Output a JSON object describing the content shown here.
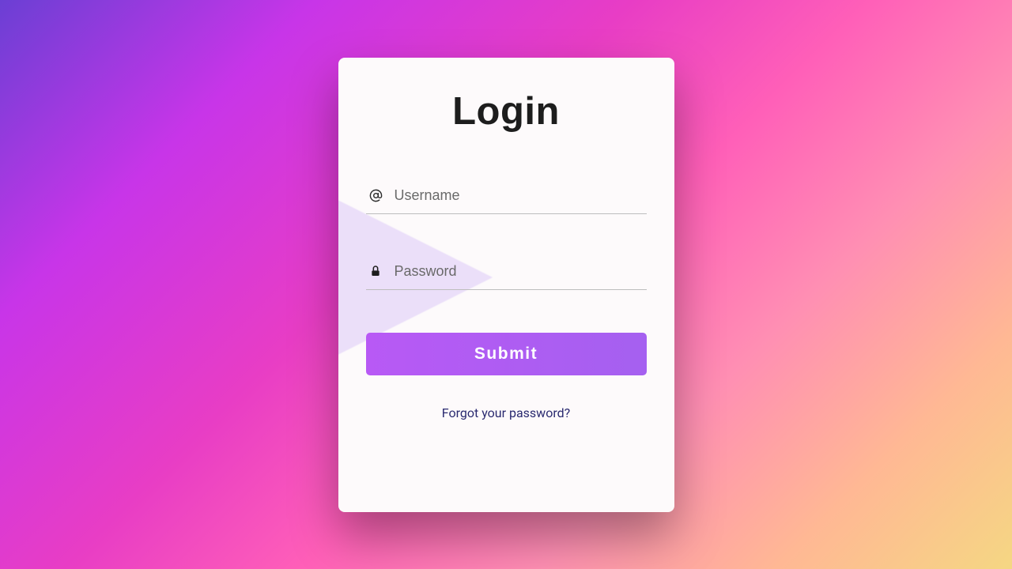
{
  "card": {
    "title": "Login",
    "username": {
      "placeholder": "Username",
      "value": "",
      "icon": "at-icon"
    },
    "password": {
      "placeholder": "Password",
      "value": "",
      "icon": "lock-icon"
    },
    "submit_label": "Submit",
    "forgot_label": "Forgot your password?"
  },
  "colors": {
    "button_gradient_start": "#b859f5",
    "button_gradient_end": "#a560f0",
    "link_color": "#2a2a70"
  }
}
